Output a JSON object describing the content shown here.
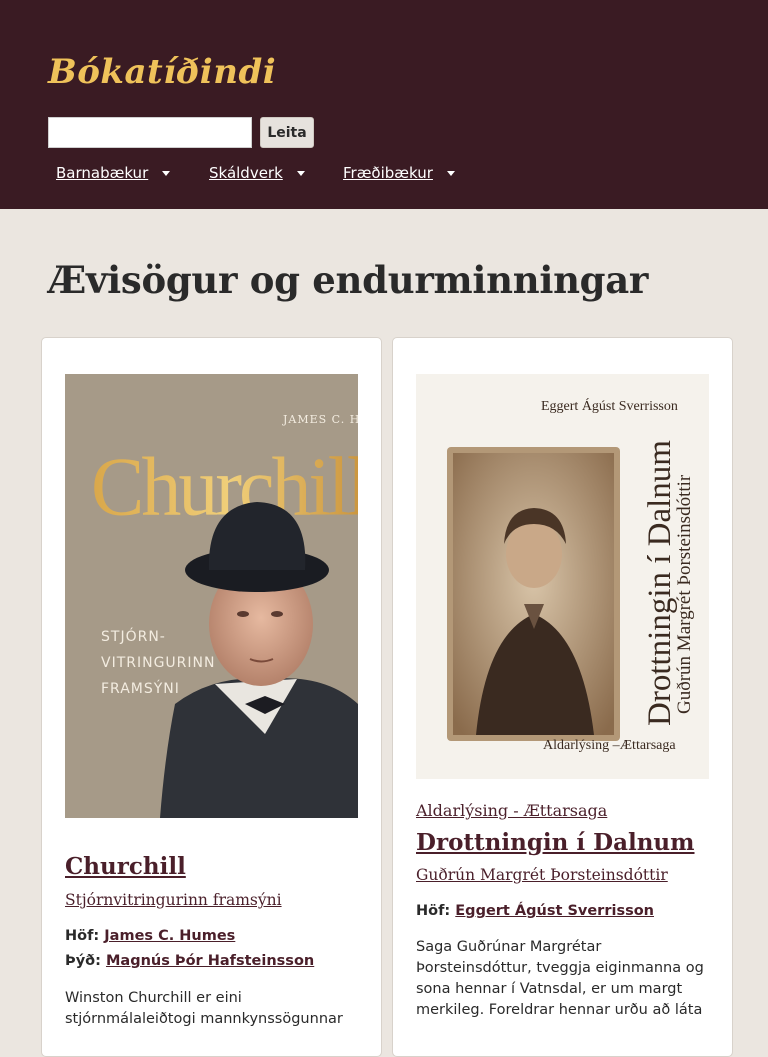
{
  "header": {
    "logo": "Bókatíðindi",
    "search": {
      "value": "",
      "placeholder": ""
    },
    "search_button": "Leita",
    "nav": [
      {
        "label": "Barnabækur"
      },
      {
        "label": "Skáldverk"
      },
      {
        "label": "Fræðibækur"
      }
    ]
  },
  "page": {
    "title": "Ævisögur og endurminningar"
  },
  "books": [
    {
      "cover": {
        "author": "JAMES C. HUMES",
        "title": "Churchill",
        "subtitle_lines": [
          "STJÓRN-",
          "VITRINGURINN",
          "FRAMSÝNI"
        ]
      },
      "title": "Churchill",
      "subtitle": "Stjórnvitringurinn framsýni",
      "credits": [
        {
          "role": "Höf:",
          "name": "James C. Humes"
        },
        {
          "role": "Þýð:",
          "name": "Magnús Þór Hafsteinsson"
        }
      ],
      "description": "Winston Churchill er eini stjórnmálaleiðtogi mannkynssögunnar"
    },
    {
      "cover": {
        "author": "Eggert Ágúst Sverrisson",
        "title": "Drottningin í Dalnum",
        "subject": "Guðrún Margrét Þorsteinsdóttir",
        "footer": "Aldarlýsing –Ættarsaga"
      },
      "genre": "Aldarlýsing - Ættarsaga",
      "title": "Drottningin í Dalnum",
      "subtitle": "Guðrún Margrét Þorsteinsdóttir",
      "credits": [
        {
          "role": "Höf:",
          "name": "Eggert Ágúst Sverrisson"
        }
      ],
      "description": "Saga Guðrúnar Margrétar Þorsteinsdóttur, tveggja eiginmanna og sona hennar í Vatnsdal, er um margt merkileg. Foreldrar hennar urðu að láta"
    }
  ],
  "colors": {
    "header_bg": "#3a1b23",
    "logo": "#efc25a",
    "link": "#4a1f2a",
    "page_bg": "#ebe6e0"
  }
}
